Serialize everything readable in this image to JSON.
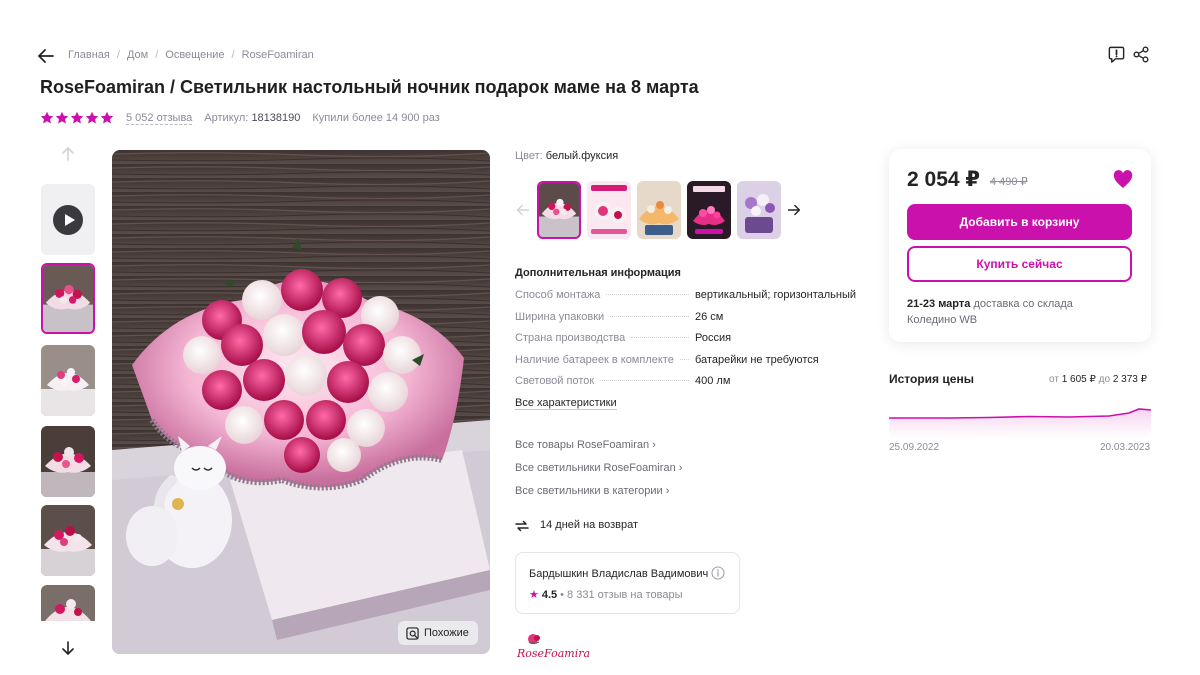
{
  "breadcrumbs": [
    "Главная",
    "Дом",
    "Освещение",
    "RoseFoamiran"
  ],
  "title": "RoseFoamiran / Светильник настольный ночник подарок маме на 8 марта",
  "rating": {
    "stars": 5,
    "reviews_label": "5 052 отзыва"
  },
  "article": {
    "label": "Артикул:",
    "value": "18138190"
  },
  "bought_label": "Купили более 14 900 раз",
  "gallery": {
    "thumbnails": [
      "video",
      "photo-1",
      "photo-2",
      "photo-3",
      "photo-4",
      "photo-5"
    ],
    "active_index": 1,
    "similar_label": "Похожие"
  },
  "color": {
    "label": "Цвет:",
    "value": "белый.фуксия"
  },
  "color_variants": [
    "variant-1",
    "variant-2",
    "variant-3",
    "variant-4",
    "variant-5"
  ],
  "specs": {
    "title": "Дополнительная информация",
    "rows": [
      {
        "key": "Способ монтажа",
        "value": "вертикальный; горизонтальный"
      },
      {
        "key": "Ширина упаковки",
        "value": "26 см"
      },
      {
        "key": "Страна производства",
        "value": "Россия"
      },
      {
        "key": "Наличие батареек в комплекте",
        "value": "батарейки не требуются"
      },
      {
        "key": "Световой поток",
        "value": "400 лм"
      }
    ],
    "all_link": "Все характеристики"
  },
  "brand_links": [
    "Все товары RoseFoamiran",
    "Все светильники RoseFoamiran",
    "Все светильники в категории"
  ],
  "return_policy": "14 дней на возврат",
  "seller": {
    "name": "Бардышкин Владислав Вадимович",
    "rating": "4.5",
    "reviews": "8 331 отзыв на товары"
  },
  "brand_logo_text": "RoseFoamiran",
  "price": {
    "current": "2 054 ₽",
    "old": "4 490 ₽",
    "add_to_cart": "Добавить в корзину",
    "buy_now": "Купить сейчас",
    "delivery_dates": "21-23 марта",
    "delivery_text": "доставка со склада",
    "warehouse": "Коледино WB"
  },
  "price_history": {
    "title": "История цены",
    "range_from_label": "от",
    "min": "1 605 ₽",
    "range_to_label": "до",
    "max": "2 373 ₽",
    "start_date": "25.09.2022",
    "end_date": "20.03.2023"
  },
  "colors": {
    "accent": "#cb11ab",
    "text": "#242424",
    "muted": "#8b8b99"
  }
}
